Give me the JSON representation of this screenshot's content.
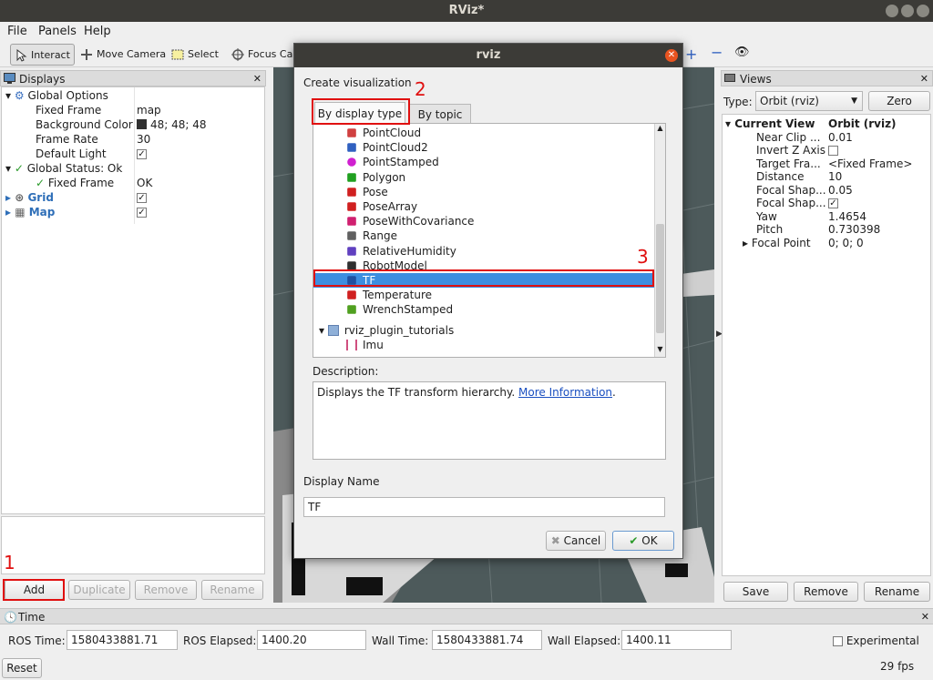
{
  "window": {
    "title": "RViz*"
  },
  "menu": {
    "file": "File",
    "panels": "Panels",
    "help": "Help"
  },
  "toolbar": {
    "interact": "Interact",
    "move_camera": "Move Camera",
    "select": "Select",
    "focus_camera": "Focus Came"
  },
  "displays": {
    "title": "Displays",
    "rows": {
      "global_options": "Global Options",
      "fixed_frame_label": "Fixed Frame",
      "fixed_frame_value": "map",
      "bg_color_label": "Background Color",
      "bg_color_value": "48; 48; 48",
      "frame_rate_label": "Frame Rate",
      "frame_rate_value": "30",
      "default_light_label": "Default Light",
      "global_status_label": "Global Status: Ok",
      "status_fixed_frame_label": "Fixed Frame",
      "status_fixed_frame_value": "OK",
      "grid": "Grid",
      "map": "Map"
    },
    "buttons": {
      "add": "Add",
      "duplicate": "Duplicate",
      "remove": "Remove",
      "rename": "Rename"
    }
  },
  "views": {
    "title": "Views",
    "type_label": "Type:",
    "type_value": "Orbit (rviz)",
    "zero": "Zero",
    "rows": {
      "current_view_label": "Current View",
      "current_view_value": "Orbit (rviz)",
      "near_clip_label": "Near Clip ...",
      "near_clip_value": "0.01",
      "invert_z_label": "Invert Z Axis",
      "target_frame_label": "Target Fra...",
      "target_frame_value": "<Fixed Frame>",
      "distance_label": "Distance",
      "distance_value": "10",
      "focal_shape1_label": "Focal Shap...",
      "focal_shape1_value": "0.05",
      "focal_shape2_label": "Focal Shap...",
      "yaw_label": "Yaw",
      "yaw_value": "1.4654",
      "pitch_label": "Pitch",
      "pitch_value": "0.730398",
      "focal_point_label": "Focal Point",
      "focal_point_value": "0; 0; 0"
    },
    "buttons": {
      "save": "Save",
      "remove": "Remove",
      "rename": "Rename"
    }
  },
  "time": {
    "title": "Time",
    "ros_time_label": "ROS Time:",
    "ros_time_value": "1580433881.71",
    "ros_elapsed_label": "ROS Elapsed:",
    "ros_elapsed_value": "1400.20",
    "wall_time_label": "Wall Time:",
    "wall_time_value": "1580433881.74",
    "wall_elapsed_label": "Wall Elapsed:",
    "wall_elapsed_value": "1400.11",
    "experimental": "Experimental",
    "reset": "Reset",
    "fps": "29 fps"
  },
  "dialog": {
    "title": "rviz",
    "create_label": "Create visualization",
    "tab_display_type": "By display type",
    "tab_topic": "By topic",
    "items": [
      {
        "label": "PointCloud",
        "icon": "pointcloud-icon",
        "color": "#d04040"
      },
      {
        "label": "PointCloud2",
        "icon": "pointcloud2-icon",
        "color": "#3060c0"
      },
      {
        "label": "PointStamped",
        "icon": "point-icon",
        "color": "#d020d0"
      },
      {
        "label": "Polygon",
        "icon": "polygon-icon",
        "color": "#20a020"
      },
      {
        "label": "Pose",
        "icon": "pose-icon",
        "color": "#d02020"
      },
      {
        "label": "PoseArray",
        "icon": "posearray-icon",
        "color": "#d02020"
      },
      {
        "label": "PoseWithCovariance",
        "icon": "posecov-icon",
        "color": "#d02070"
      },
      {
        "label": "Range",
        "icon": "range-icon",
        "color": "#606060"
      },
      {
        "label": "RelativeHumidity",
        "icon": "humidity-icon",
        "color": "#6040c0"
      },
      {
        "label": "RobotModel",
        "icon": "robot-icon",
        "color": "#303030"
      },
      {
        "label": "TF",
        "icon": "tf-icon",
        "color": "#2050a0"
      },
      {
        "label": "Temperature",
        "icon": "temperature-icon",
        "color": "#d02020"
      },
      {
        "label": "WrenchStamped",
        "icon": "wrench-icon",
        "color": "#50a020"
      }
    ],
    "plugin_group": "rviz_plugin_tutorials",
    "plugin_item": "Imu",
    "description_label": "Description:",
    "description_text": "Displays the TF transform hierarchy. ",
    "description_link": "More Information",
    "description_end": ".",
    "display_name_label": "Display Name",
    "display_name_value": "TF",
    "cancel": "Cancel",
    "ok": "OK"
  },
  "annotations": {
    "step1": "1",
    "step2": "2",
    "step3": "3"
  },
  "colors": {
    "selection": "#3d8ee0",
    "annotation": "#e01010",
    "link": "#1a4fc0"
  }
}
